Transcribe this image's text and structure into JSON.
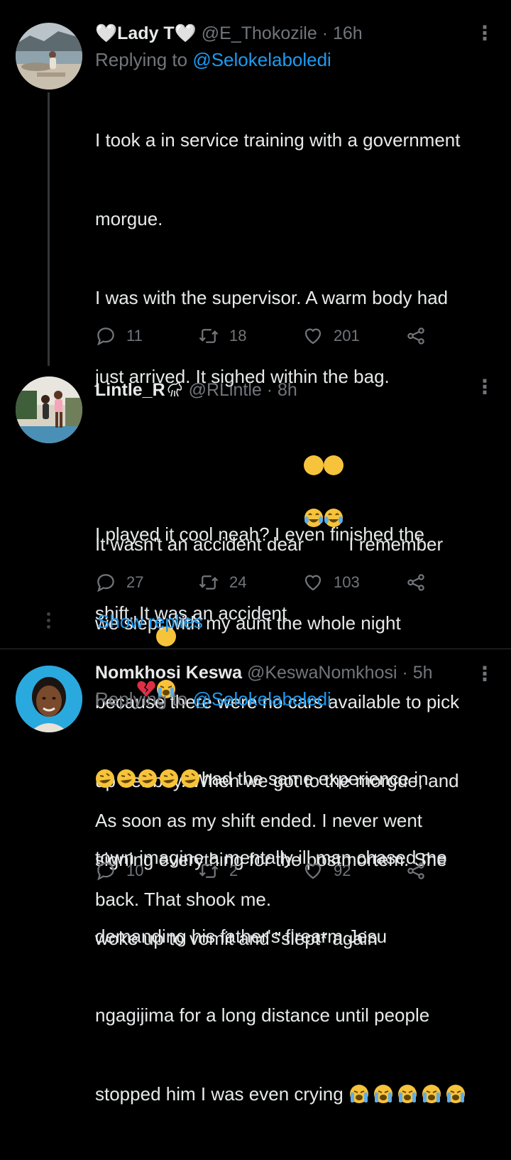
{
  "tweets": [
    {
      "name": "🤍Lady T🤍",
      "handle": "@E_Thokozile",
      "time": "16h",
      "replying_label": "Replying to",
      "replying_to": "@Selokelaboledi",
      "text_lines": [
        "I took a in service training with a government",
        "morgue.",
        "I was with the supervisor. A warm body had",
        "just arrived. It sighed within the bag.",
        "",
        "I played it cool neah? I even finished the",
        "shift. It was an accident",
        "As soon as my shift ended. I never went",
        "back. That shook me."
      ],
      "replies": "11",
      "retweets": "18",
      "likes": "201"
    },
    {
      "name": "Lintle_R",
      "handle": "@RLintle",
      "time": "8h",
      "text_lines": [
        "It wasn't an accident dear",
        " I remember",
        "we slept with my aunt the whole night",
        "because there were no cars available to pick",
        "up her boy. When we got to the morgue, and",
        "signing everything for the postmortem. She",
        "woke up to vomit and \"slept* again"
      ],
      "replies": "27",
      "retweets": "24",
      "likes": "103"
    },
    {
      "name": "Nomkhosi Keswa",
      "handle": "@KeswaNomkhosi",
      "time": "5h",
      "replying_label": "Replying to",
      "replying_to": "@Selokelaboledi",
      "text_lines": [
        "had the same experience in",
        "town imagine a mentally ill man chased me",
        "demanding his father's firearm Jesu",
        "ngagijima for a long distance until people",
        "stopped him I was even crying"
      ],
      "replies": "10",
      "retweets": "2",
      "likes": "92"
    }
  ],
  "show_replies": "Show replies",
  "dot": "·",
  "colors": {
    "background": "#000000",
    "text": "#e7e9ea",
    "muted": "#71767b",
    "accent": "#1d9bf0"
  },
  "icons": [
    "reply-icon",
    "retweet-icon",
    "like-icon",
    "share-icon",
    "more-icon"
  ]
}
